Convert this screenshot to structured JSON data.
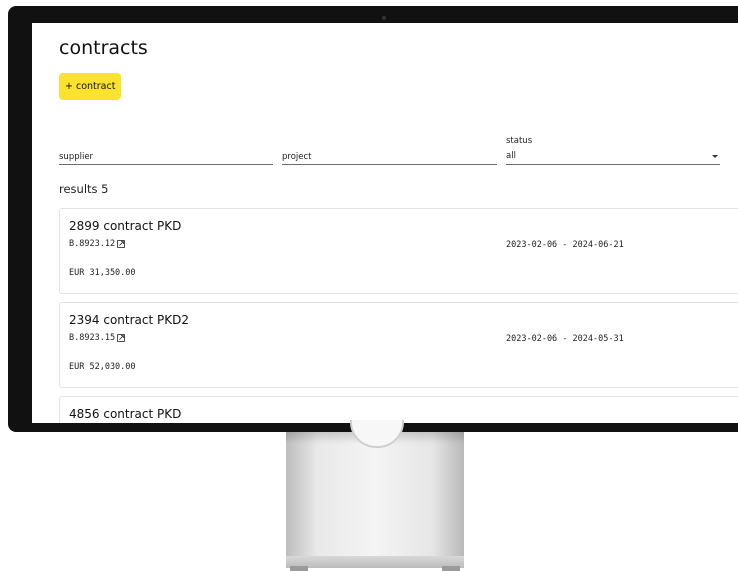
{
  "page": {
    "title": "contracts",
    "add_button_label": "+ contract"
  },
  "filters": {
    "supplier_placeholder": "supplier",
    "project_placeholder": "project",
    "status_label": "status",
    "status_value": "all"
  },
  "results": {
    "label": "results 5"
  },
  "contracts": [
    {
      "title": "2899 contract PKD",
      "ref": "B.8923.12",
      "dates": "2023-02-06 - 2024-06-21",
      "amount": "EUR 31,350.00"
    },
    {
      "title": "2394 contract PKD2",
      "ref": "B.8923.15",
      "dates": "2023-02-06 - 2024-05-31",
      "amount": "EUR 52,030.00"
    },
    {
      "title": "4856 contract PKD"
    }
  ],
  "icons": {
    "add": "plus-icon",
    "ref_link": "external-link-icon",
    "status_dropdown": "caret-down-icon"
  },
  "colors": {
    "accent_button": "#fbe22d",
    "monitor_bezel": "#111111"
  }
}
